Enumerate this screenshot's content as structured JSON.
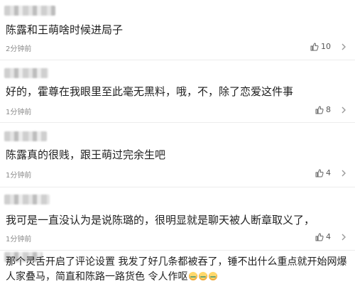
{
  "comments": [
    {
      "text": "陈露和王萌啥时候进局子",
      "time": "2分钟前",
      "likes": "10"
    },
    {
      "text": "好的，霍尊在我眼里至此毫无黑料，哦，不，除了恋爱这件事",
      "time": "1分钟前",
      "likes": "8"
    },
    {
      "text": "陈露真的很贱，跟王萌过完余生吧",
      "time": "1分钟前",
      "likes": "4"
    },
    {
      "text": "我可是一直没认为是说陈璐的，很明显就是聊天被人断章取义了，",
      "time": "1分钟前",
      "likes": "4"
    },
    {
      "text": "那个灵舌开启了评论设置 我发了好几条都被吞了，锤不出什么重点就开始网爆人家叠马，简直和陈路一路货色 令人作呕",
      "emojis": 3
    }
  ],
  "icons": {
    "like": "thumbs-up-icon",
    "more": "chevron-right-icon",
    "emoji": "nauseated-face-emoji"
  }
}
